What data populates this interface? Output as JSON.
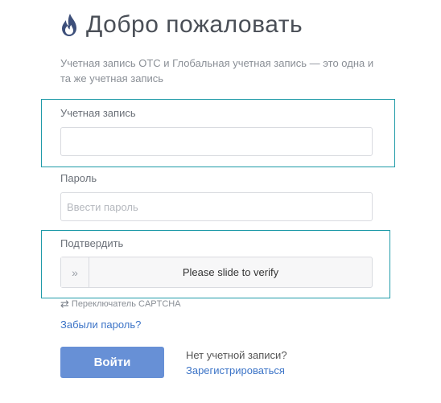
{
  "header": {
    "title": "Добро пожаловать",
    "logo_icon": "flame-icon",
    "logo_color": "#3d4f7a"
  },
  "intro": {
    "text": "Учетная запись OTC и Глобальная учетная запись — это одна и та же учетная запись"
  },
  "form": {
    "account": {
      "label": "Учетная запись",
      "value": "",
      "placeholder": ""
    },
    "password": {
      "label": "Пароль",
      "value": "",
      "placeholder": "Ввести пароль"
    },
    "verify": {
      "label": "Подтвердить",
      "slider_text": "Please slide to verify",
      "handle_icon": "double-chevron-right-icon"
    },
    "captcha_switch": {
      "label": "Переключатель CAPTCHA",
      "icon": "swap-arrows-icon"
    },
    "forgot_password": "Забыли пароль?",
    "login_button": "Войти",
    "no_account": "Нет учетной записи?",
    "register_link": "Зарегистрироваться"
  },
  "colors": {
    "accent_button": "#6790d6",
    "link": "#3c74c7",
    "highlight_border": "#1f9aa8"
  }
}
